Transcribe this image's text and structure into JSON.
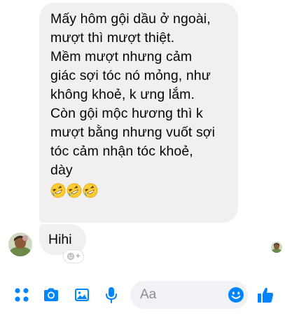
{
  "message_main": {
    "lines": [
      "Mấy hôm gội dầu ở ngoài,",
      "mượt thì mượt thiệt.",
      "Mềm mượt nhưng cảm",
      "giác sợi tóc nó mỏng, như",
      "không khoẻ, k ưng lắm.",
      "Còn gội mộc hương thì k",
      "mượt bằng nhưng vuốt sợi",
      "tóc cảm nhận tóc khoẻ,",
      "dày"
    ],
    "emojis": [
      "rolling-on-floor-laughing",
      "rolling-on-floor-laughing",
      "rolling-on-floor-laughing"
    ]
  },
  "message_reply": {
    "text": "Hihi"
  },
  "reaction_add": {
    "icon": "add-reaction-icon",
    "plus": "+"
  },
  "composer": {
    "placeholder": "Aa"
  },
  "toolbar": {
    "icons": [
      "menu-grid-icon",
      "camera-icon",
      "gallery-icon",
      "microphone-icon",
      "emoji-icon",
      "thumbs-up-icon"
    ]
  },
  "colors": {
    "accent": "#0084ff",
    "bubble": "#f0f0f0",
    "composer_bg": "#f0f2f5",
    "placeholder": "#8a8d91"
  }
}
